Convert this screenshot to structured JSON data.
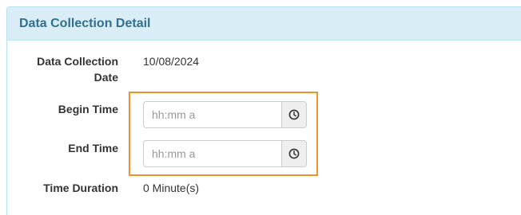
{
  "panel": {
    "title": "Data Collection Detail"
  },
  "fields": {
    "collection_date": {
      "label_line1": "Data Collection",
      "label_line2": "Date",
      "value": "10/08/2024"
    },
    "begin_time": {
      "label": "Begin Time",
      "value": "",
      "placeholder": "hh:mm a",
      "icon": "clock-icon"
    },
    "end_time": {
      "label": "End Time",
      "value": "",
      "placeholder": "hh:mm a",
      "icon": "clock-icon"
    },
    "time_duration": {
      "label": "Time Duration",
      "value": "0 Minute(s)"
    }
  },
  "colors": {
    "heading_bg": "#d9edf7",
    "heading_text": "#31708f",
    "highlight_border": "#f0922b"
  }
}
